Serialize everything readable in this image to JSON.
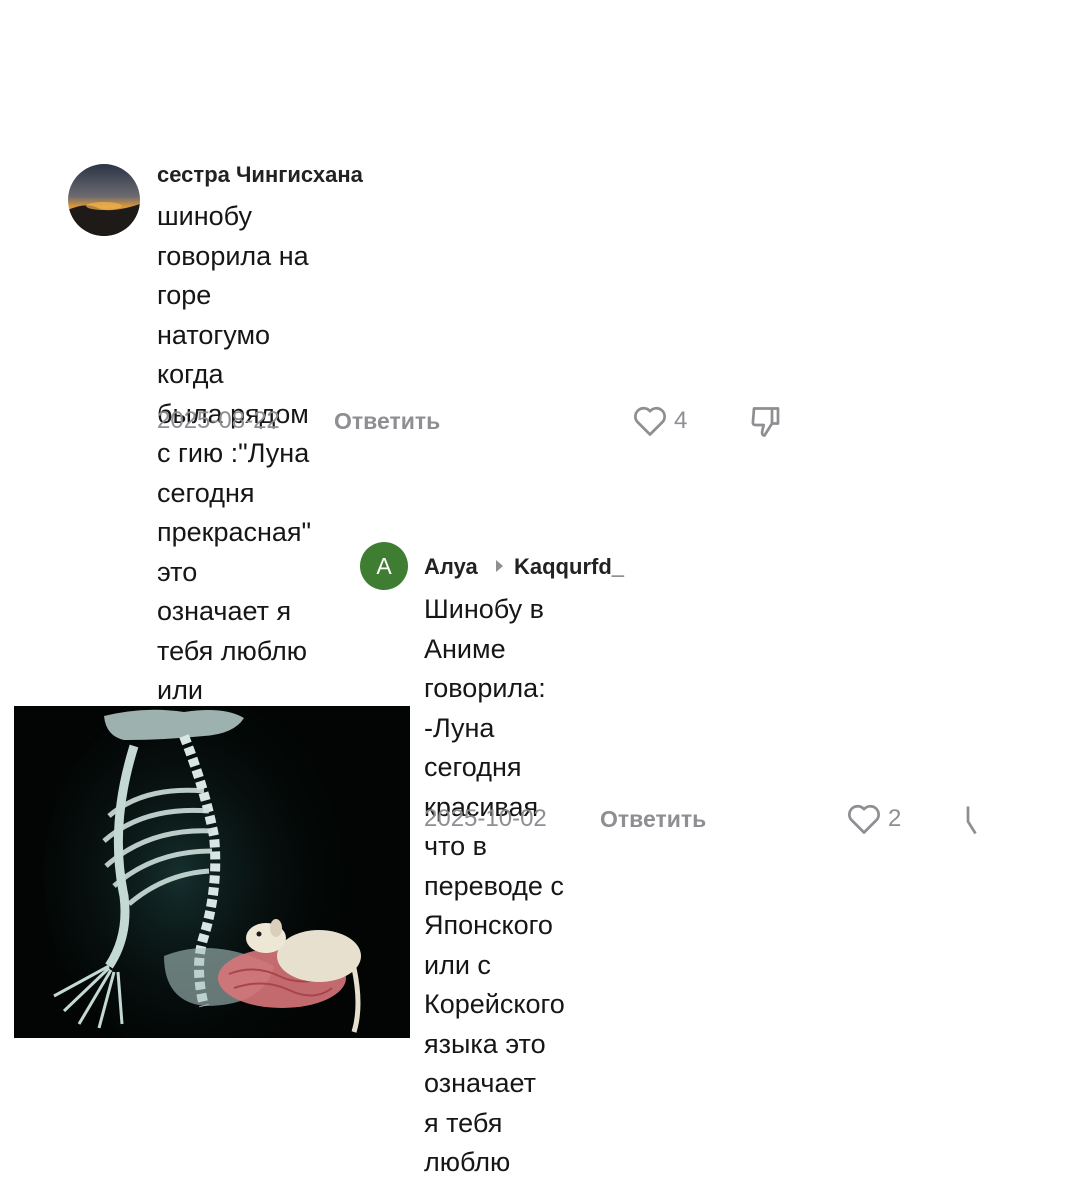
{
  "comment1": {
    "username": "сестра Чингисхана",
    "text": "шинобу говорила на горе натогумо когда\nбыла рядом с гию :\"Луна сегодня\nпрекрасная\" это означает я тебя люблю или\nты мне нравишься но кажется гию не\nпонимает намёков",
    "date": "2025-08-22",
    "reply_label": "Ответить",
    "likes": "4",
    "avatar_icon": "sunset-avatar-icon"
  },
  "comment2": {
    "avatar_letter": "A",
    "avatar_color": "#3f7d33",
    "username": "Алуа",
    "reply_to": "Kaqqurfd_",
    "text": "Шинобу в Аниме говорила:\n-Луна сегодня красивая\nчто в переводе с Японского или с\nКорейского языка это означает\nя тебя люблю",
    "date": "2025-10-02",
    "reply_label": "Ответить",
    "likes": "2"
  },
  "photo": {
    "description_icon": "xray-skeleton-with-dog-icon"
  }
}
